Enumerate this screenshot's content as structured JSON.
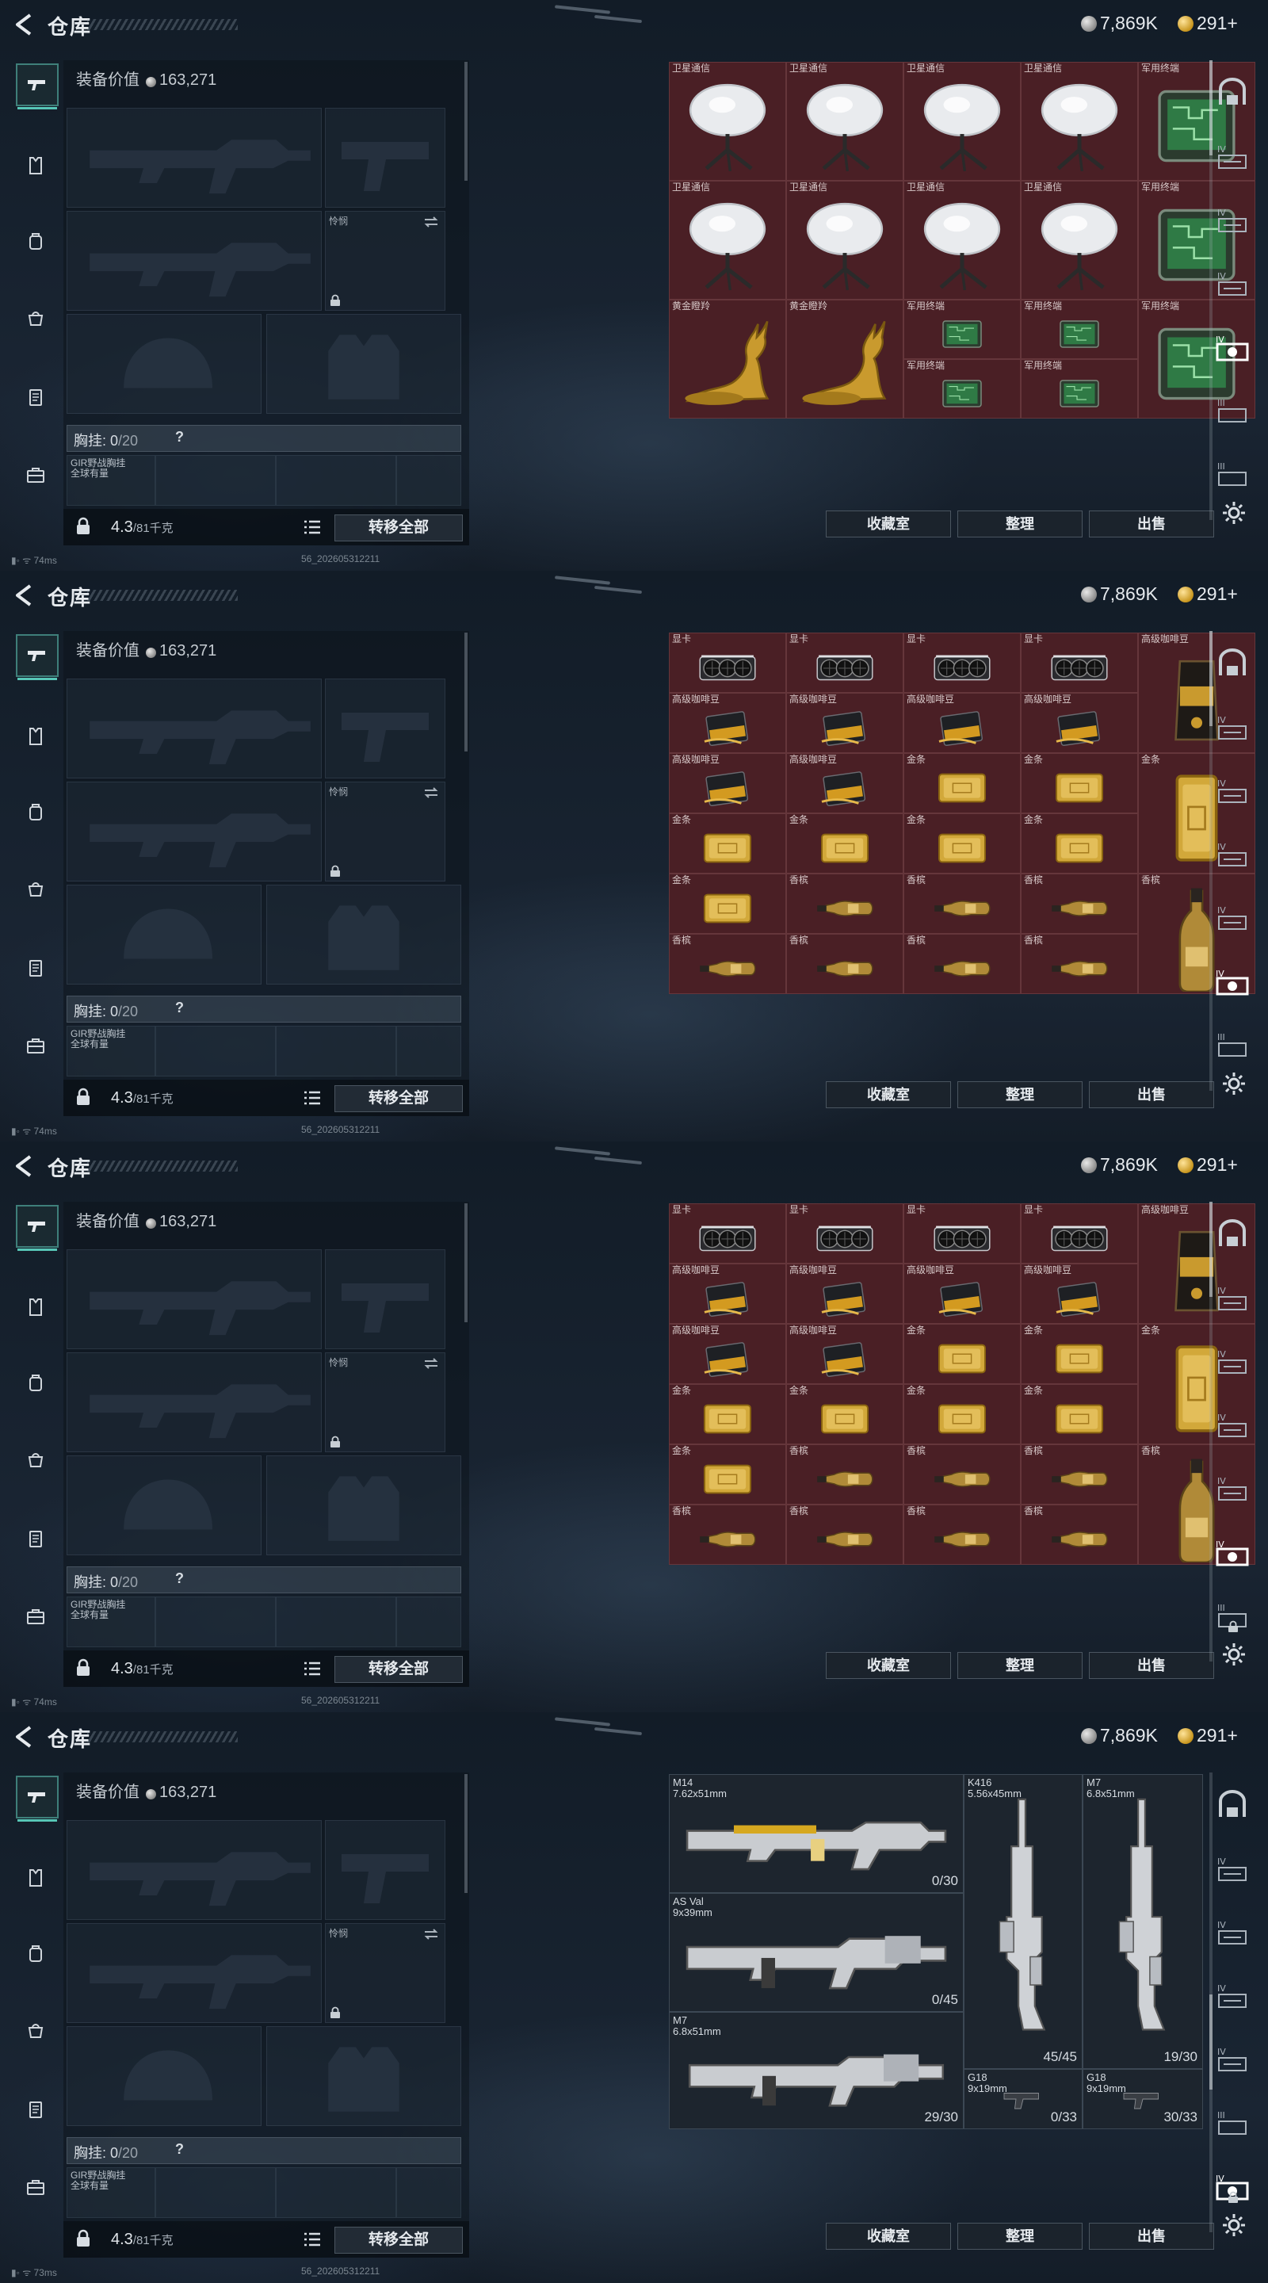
{
  "title": "仓库",
  "currency": {
    "silver": "7,869K",
    "gold": "291+"
  },
  "equipment": {
    "value_label": "装备价值",
    "value": "163,271",
    "slot_label": "怜悯",
    "chest_label": "胸挂: ",
    "chest_used": "0",
    "chest_max": "/20",
    "chest_help": "?",
    "rig_item_label": "GIR野战胸挂 全球有量",
    "weight": "4.3",
    "weight_max": "/81千克",
    "transfer_label": "转移全部"
  },
  "buttons": {
    "collection": "收藏室",
    "organize": "整理",
    "sell": "出售"
  },
  "status": {
    "ping": "74ms",
    "ping_last": "73ms",
    "build": "56_202605312211"
  },
  "panels": [
    {
      "name": "panel-1",
      "stash_type": "grid",
      "cells": [
        {
          "label": "卫星通信",
          "icon": "satellite-dish"
        },
        {
          "label": "卫星通信",
          "icon": "satellite-dish"
        },
        {
          "label": "卫星通信",
          "icon": "satellite-dish"
        },
        {
          "label": "卫星通信",
          "icon": "satellite-dish"
        },
        {
          "label": "军用终端",
          "icon": "military-terminal"
        },
        {
          "label": "卫星通信",
          "icon": "satellite-dish"
        },
        {
          "label": "卫星通信",
          "icon": "satellite-dish"
        },
        {
          "label": "卫星通信",
          "icon": "satellite-dish"
        },
        {
          "label": "卫星通信",
          "icon": "satellite-dish"
        },
        {
          "label": "军用终端",
          "icon": "military-terminal"
        },
        {
          "label": "黄金瞪羚",
          "icon": "golden-gazelle"
        },
        {
          "label": "黄金瞪羚",
          "icon": "golden-gazelle"
        },
        {
          "label": "军用终端",
          "icon": "military-terminal"
        },
        {
          "label": "军用终端",
          "icon": "military-terminal"
        },
        {
          "label": "军用终端",
          "icon": "military-terminal"
        },
        {
          "label": "军用终端",
          "icon": "military-terminal"
        },
        {
          "label": "军用终端",
          "icon": "military-terminal"
        }
      ]
    },
    {
      "name": "panel-2",
      "stash_type": "grid",
      "cells": [
        {
          "label": "显卡",
          "icon": "graphics-card"
        },
        {
          "label": "显卡",
          "icon": "graphics-card"
        },
        {
          "label": "显卡",
          "icon": "graphics-card"
        },
        {
          "label": "显卡",
          "icon": "graphics-card"
        },
        {
          "label": "高级咖啡豆",
          "icon": "coffee-bag"
        },
        {
          "label": "高级咖啡豆",
          "icon": "coffee-box"
        },
        {
          "label": "高级咖啡豆",
          "icon": "coffee-box"
        },
        {
          "label": "高级咖啡豆",
          "icon": "coffee-box"
        },
        {
          "label": "高级咖啡豆",
          "icon": "coffee-box"
        },
        {
          "label": "高级咖啡豆",
          "icon": "coffee-box"
        },
        {
          "label": "高级咖啡豆",
          "icon": "coffee-box"
        },
        {
          "label": "金条",
          "icon": "gold-bar"
        },
        {
          "label": "金条",
          "icon": "gold-bar"
        },
        {
          "label": "金条",
          "icon": "gold-bar-v"
        },
        {
          "label": "金条",
          "icon": "gold-bar"
        },
        {
          "label": "金条",
          "icon": "gold-bar"
        },
        {
          "label": "金条",
          "icon": "gold-bar"
        },
        {
          "label": "金条",
          "icon": "gold-bar"
        },
        {
          "label": "金条",
          "icon": "gold-bar"
        },
        {
          "label": "香槟",
          "icon": "champagne"
        },
        {
          "label": "香槟",
          "icon": "champagne"
        },
        {
          "label": "香槟",
          "icon": "champagne"
        },
        {
          "label": "香槟",
          "icon": "champagne-v"
        },
        {
          "label": "香槟",
          "icon": "champagne"
        },
        {
          "label": "香槟",
          "icon": "champagne"
        },
        {
          "label": "香槟",
          "icon": "champagne"
        },
        {
          "label": "香槟",
          "icon": "champagne"
        }
      ]
    },
    {
      "name": "panel-3",
      "stash_type": "grid",
      "cells": [
        {
          "label": "显卡",
          "icon": "graphics-card"
        },
        {
          "label": "显卡",
          "icon": "graphics-card"
        },
        {
          "label": "显卡",
          "icon": "graphics-card"
        },
        {
          "label": "显卡",
          "icon": "graphics-card"
        },
        {
          "label": "高级咖啡豆",
          "icon": "coffee-bag"
        },
        {
          "label": "高级咖啡豆",
          "icon": "coffee-box"
        },
        {
          "label": "高级咖啡豆",
          "icon": "coffee-box"
        },
        {
          "label": "高级咖啡豆",
          "icon": "coffee-box"
        },
        {
          "label": "高级咖啡豆",
          "icon": "coffee-box"
        },
        {
          "label": "高级咖啡豆",
          "icon": "coffee-box"
        },
        {
          "label": "高级咖啡豆",
          "icon": "coffee-box"
        },
        {
          "label": "金条",
          "icon": "gold-bar"
        },
        {
          "label": "金条",
          "icon": "gold-bar"
        },
        {
          "label": "金条",
          "icon": "gold-bar-v"
        },
        {
          "label": "金条",
          "icon": "gold-bar"
        },
        {
          "label": "金条",
          "icon": "gold-bar"
        },
        {
          "label": "金条",
          "icon": "gold-bar"
        },
        {
          "label": "金条",
          "icon": "gold-bar"
        },
        {
          "label": "金条",
          "icon": "gold-bar"
        },
        {
          "label": "香槟",
          "icon": "champagne"
        },
        {
          "label": "香槟",
          "icon": "champagne"
        },
        {
          "label": "香槟",
          "icon": "champagne"
        },
        {
          "label": "香槟",
          "icon": "champagne-v"
        },
        {
          "label": "香槟",
          "icon": "champagne"
        },
        {
          "label": "香槟",
          "icon": "champagne"
        },
        {
          "label": "香槟",
          "icon": "champagne"
        },
        {
          "label": "香槟",
          "icon": "champagne"
        }
      ]
    },
    {
      "name": "panel-4",
      "stash_type": "weapons",
      "weapons": [
        {
          "name": "M14",
          "caliber": "7.62x51mm",
          "ammo": "0/30"
        },
        {
          "name": "K416",
          "caliber": "5.56x45mm",
          "ammo": "45/45"
        },
        {
          "name": "M7",
          "caliber": "6.8x51mm",
          "ammo": "19/30"
        },
        {
          "name": "AS Val",
          "caliber": "9x39mm",
          "ammo": "0/45"
        },
        {
          "name": "M7",
          "caliber": "6.8x51mm",
          "ammo": "29/30"
        },
        {
          "name": "G18",
          "caliber": "9x19mm",
          "ammo": "0/33"
        },
        {
          "name": "G18",
          "caliber": "9x19mm",
          "ammo": "30/33"
        }
      ]
    }
  ]
}
